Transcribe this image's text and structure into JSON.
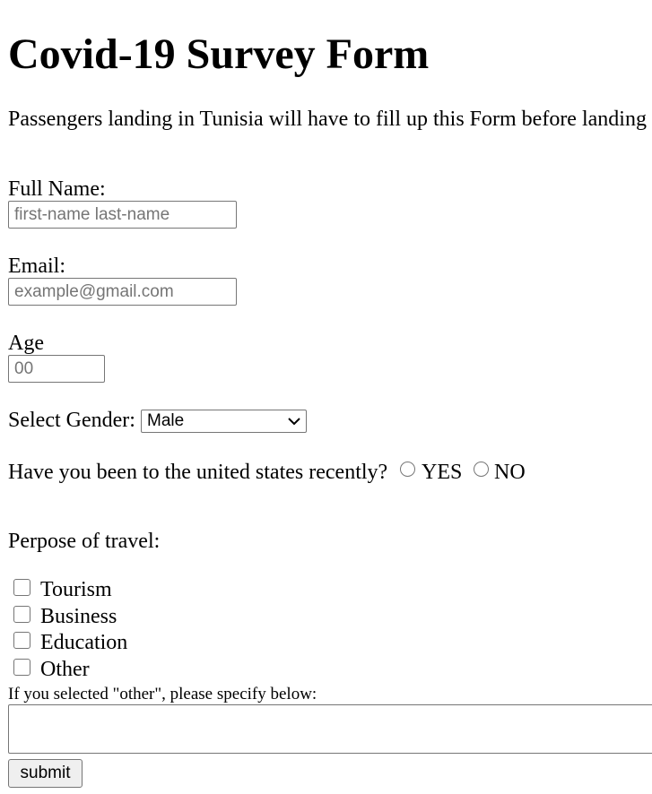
{
  "title": "Covid-19 Survey Form",
  "intro": "Passengers landing in Tunisia will have to fill up this Form before landing",
  "fields": {
    "full_name": {
      "label": "Full Name:",
      "placeholder": "first-name last-name",
      "value": ""
    },
    "email": {
      "label": "Email:",
      "placeholder": "example@gmail.com",
      "value": ""
    },
    "age": {
      "label": "Age",
      "placeholder": "00",
      "value": ""
    }
  },
  "gender": {
    "label": "Select Gender:",
    "selected": "Male"
  },
  "us_travel": {
    "question": "Have you been to the united states recently?",
    "options": [
      {
        "label": "YES",
        "checked": false
      },
      {
        "label": "NO",
        "checked": false
      }
    ]
  },
  "purpose": {
    "label": "Perpose of travel:",
    "options": [
      {
        "label": "Tourism",
        "checked": false
      },
      {
        "label": "Business",
        "checked": false
      },
      {
        "label": "Education",
        "checked": false
      },
      {
        "label": "Other",
        "checked": false
      }
    ]
  },
  "other_note": "If you selected \"other\", please specify below:",
  "other_text": "",
  "submit_label": "submit",
  "icons": {
    "select_chevron": "chevron-down-icon"
  }
}
